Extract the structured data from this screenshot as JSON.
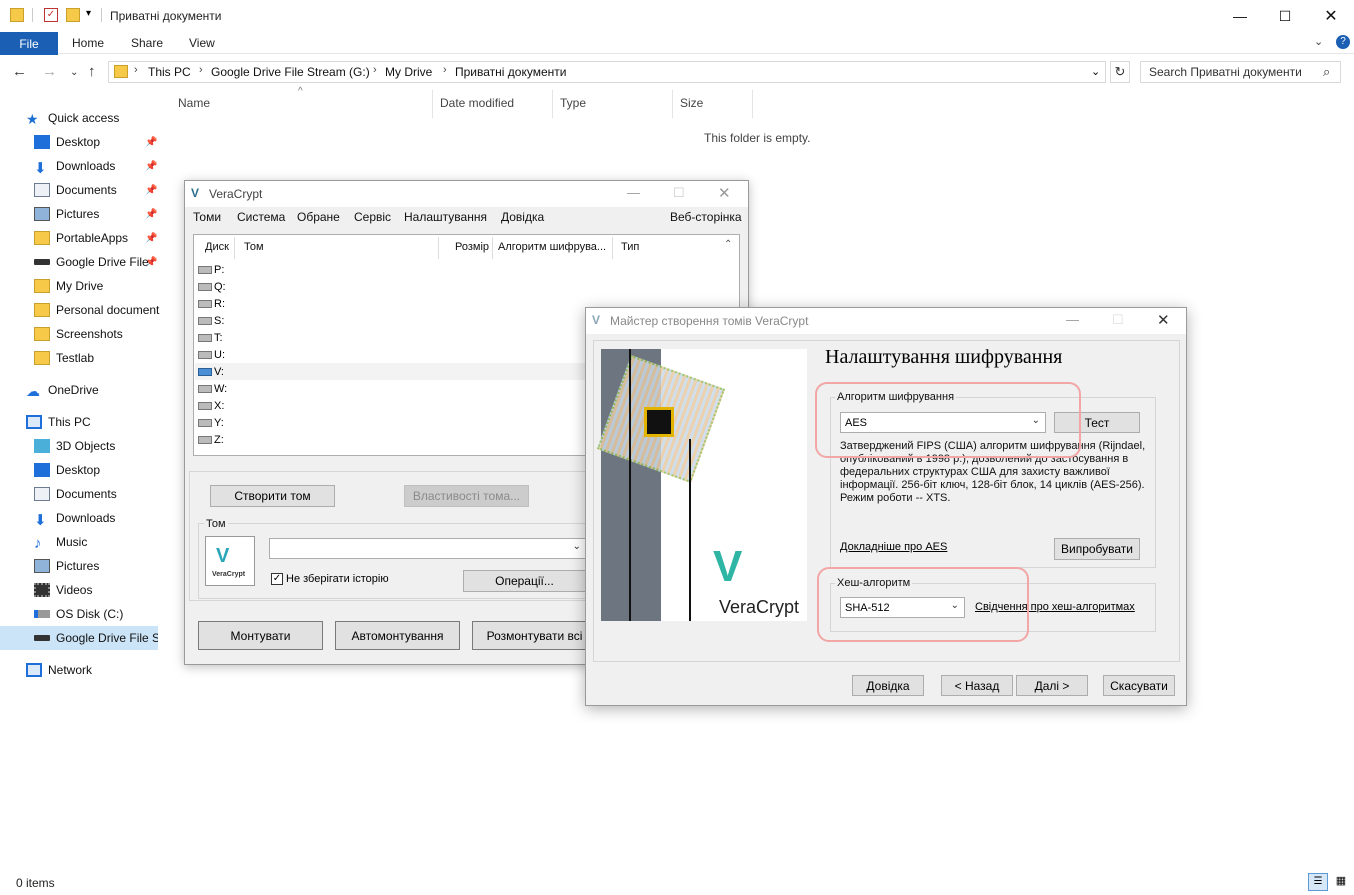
{
  "explorer": {
    "title": "Приватні документи",
    "ribbon_tabs": {
      "file": "File",
      "home": "Home",
      "share": "Share",
      "view": "View"
    },
    "address": [
      "This PC",
      "Google Drive File Stream (G:)",
      "My Drive",
      "Приватні документи"
    ],
    "search_placeholder": "Search Приватні документи",
    "columns": {
      "name": "Name",
      "date": "Date modified",
      "type": "Type",
      "size": "Size"
    },
    "empty_message": "This folder is empty.",
    "status": "0 items",
    "nav": {
      "quick_access": "Quick access",
      "quick": [
        "Desktop",
        "Downloads",
        "Documents",
        "Pictures",
        "PortableApps",
        "Google Drive File",
        "My Drive",
        "Personal document",
        "Screenshots",
        "Testlab"
      ],
      "onedrive": "OneDrive",
      "this_pc": "This PC",
      "pc": [
        "3D Objects",
        "Desktop",
        "Documents",
        "Downloads",
        "Music",
        "Pictures",
        "Videos",
        "OS Disk (C:)",
        "Google Drive File St"
      ],
      "network": "Network"
    }
  },
  "veracrypt": {
    "title": "VeraCrypt",
    "menu": [
      "Томи",
      "Система",
      "Обране",
      "Сервіс",
      "Налаштування",
      "Довідка"
    ],
    "homepage": "Веб-сторінка",
    "list_headers": {
      "drive": "Диск",
      "volume": "Том",
      "size": "Розмір",
      "algo": "Алгоритм шифрува...",
      "type": "Тип"
    },
    "drives": [
      "P:",
      "Q:",
      "R:",
      "S:",
      "T:",
      "U:",
      "V:",
      "W:",
      "X:",
      "Y:",
      "Z:"
    ],
    "create_volume": "Створити том",
    "volume_props": "Властивості тома...",
    "volume_group": "Том",
    "logo_text": "VeraCrypt",
    "no_history": "Не зберігати історію",
    "operations": "Операції...",
    "mount": "Монтувати",
    "automount": "Автомонтування",
    "dismount_all": "Розмонтувати всі"
  },
  "wizard": {
    "title": "Майстер створення томів VeraCrypt",
    "heading": "Налаштування шифрування",
    "enc_group": "Алгоритм шифрування",
    "enc_value": "AES",
    "test": "Тест",
    "description": "Затверджений FIPS (США) алгоритм шифрування (Rijndael, опублікований в 1998 р.), дозволений до застосування в федеральних структурах США для захисту важливої інформації. 256-біт ключ, 128-біт блок, 14 циклів (AES-256). Режим роботи -- XTS.",
    "more_aes": "Докладніше про AES",
    "try": "Випробувати",
    "hash_group": "Хеш-алгоритм",
    "hash_value": "SHA-512",
    "hash_info": "Свідчення про хеш-алгоритмах",
    "help": "Довідка",
    "back": "< Назад",
    "next": "Далі >",
    "cancel": "Скасувати",
    "brand": "VeraCrypt"
  }
}
